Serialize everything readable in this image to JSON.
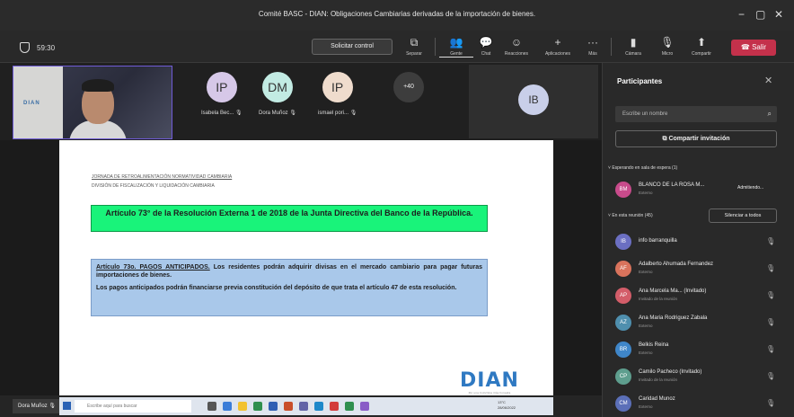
{
  "window": {
    "title": "Comité BASC - DIAN: Obligaciones Cambiarias derivadas de la importación de bienes.",
    "minimize": "−",
    "maximize": "▢",
    "close": "✕"
  },
  "toolbar": {
    "timer": "59:30",
    "request_control": "Solicitar control",
    "items": [
      {
        "label": "Separar",
        "icon": "⧉"
      },
      {
        "label": "Gente",
        "icon": "👥"
      },
      {
        "label": "Chat",
        "icon": "💬"
      },
      {
        "label": "Reacciones",
        "icon": "☺"
      },
      {
        "label": "Aplicaciones",
        "icon": "+"
      },
      {
        "label": "Más",
        "icon": "···"
      },
      {
        "label": "Cámara",
        "icon": "▮"
      },
      {
        "label": "Micro",
        "icon": "🎙"
      },
      {
        "label": "Compartir",
        "icon": "⬆"
      }
    ],
    "leave": "Salir"
  },
  "gallery": {
    "self_logo": "DIAN",
    "tiles": [
      {
        "initials": "IP",
        "name": "Isabela Bec...",
        "color": "#d6c8e8"
      },
      {
        "initials": "DM",
        "name": "Dora Muñoz",
        "color": "#c2ebe3"
      },
      {
        "initials": "IP",
        "name": "ismael pori...",
        "color": "#efdccd"
      }
    ],
    "more": "+40",
    "ib_initials": "IB"
  },
  "slide": {
    "header1": "JORNADA DE RETROALIMENTACIÓN NORMATIVIDAD CAMBIARIA",
    "header2": "DIVISIÓN DE FISCALIZACIÓN Y LIQUIDACIÓN CAMBIARIA",
    "green_title": "Artículo 73° de la Resolución Externa 1 de 2018 de la Junta Directiva del Banco de la República.",
    "article_heading": "Artículo 73o. PAGOS ANTICIPADOS.",
    "article_text1": " Los residentes podrán adquirir divisas en el mercado cambiario para pagar futuras importaciones de bienes.",
    "article_text2": "Los pagos anticipados podrán financiarse previa constitución del depósito de que trata el artículo 47 de esta resolución.",
    "logo": "DIAN",
    "logo_sub": "Por una Colombia más honesta"
  },
  "bottom": {
    "presenter": "Dora Muñoz",
    "search_placeholder": "Escribe aquí para buscar",
    "tray_line1": "13°C",
    "tray_line2": "28/06/2022"
  },
  "participants": {
    "title": "Participantes",
    "search_placeholder": "Escribe un nombre",
    "share_invite": "Compartir invitación",
    "waiting_section": "Esperando en sala de espera (1)",
    "waiting": {
      "initials": "BM",
      "name": "BLANCO DE LA ROSA M...",
      "role": "Externo",
      "action": "Admitiendo...",
      "color": "#c84b8b"
    },
    "meeting_section": "En esta reunión (45)",
    "mute_all": "Silenciar a todos",
    "people": [
      {
        "initials": "IB",
        "name": "info barranquilla",
        "role": "",
        "color": "#6b6fc2"
      },
      {
        "initials": "AF",
        "name": "Adalberto Ahumada Fernandez",
        "role": "Externo",
        "color": "#d9735c"
      },
      {
        "initials": "AP",
        "name": "Ana Marcela Ma... (Invitado)",
        "role": "Invitado de la reunión",
        "color": "#d35d69"
      },
      {
        "initials": "AZ",
        "name": "Ana Maria Rodriguez Zabala",
        "role": "Externo",
        "color": "#4f8fae"
      },
      {
        "initials": "BR",
        "name": "Belkis Reina",
        "role": "Externo",
        "color": "#3f86c9"
      },
      {
        "initials": "CP",
        "name": "Camilo Pacheco (Invitado)",
        "role": "Invitado de la reunión",
        "color": "#5e9e8e"
      },
      {
        "initials": "CM",
        "name": "Caridad Munoz",
        "role": "Externo",
        "color": "#5b6fb8"
      }
    ]
  }
}
